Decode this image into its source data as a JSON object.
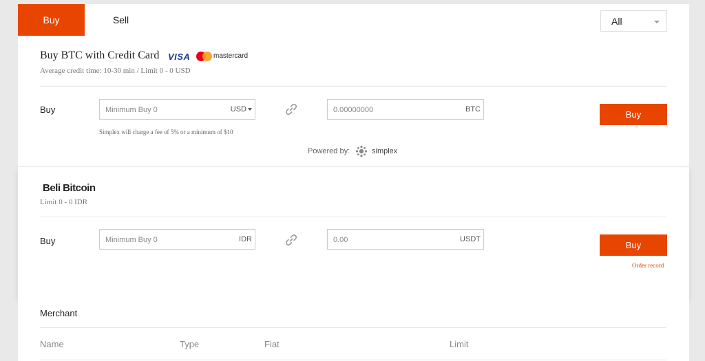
{
  "tabs": {
    "buy": "Buy",
    "sell": "Sell"
  },
  "filter": {
    "selected": "All"
  },
  "card_credit": {
    "title": "Buy BTC with Credit Card",
    "visa": "VISA",
    "mastercard": "mastercard",
    "subtitle": "Average credit time: 10-30 min / Limit 0 - 0 USD",
    "row_label": "Buy",
    "amount_placeholder": "Minimum Buy 0",
    "amount_unit": "USD",
    "crypto_placeholder": "0.00000000",
    "crypto_unit": "BTC",
    "buy_label": "Buy",
    "fee_note": "Simplex will charge a fee of 5% or a minimum of $10",
    "powered_by": "Powered by:",
    "provider": "simplex"
  },
  "card_idr": {
    "title": "Beli Bitcoin",
    "subtitle": "Limit 0 - 0 IDR",
    "row_label": "Buy",
    "amount_placeholder": "Minimum Buy 0",
    "amount_unit": "IDR",
    "crypto_placeholder": "0.00",
    "crypto_unit": "USDT",
    "buy_label": "Buy",
    "order_record": "Order record"
  },
  "merchant": {
    "title": "Merchant",
    "columns": [
      "Name",
      "Type",
      "Fiat",
      "Limit"
    ]
  },
  "colors": {
    "accent": "#e84600"
  }
}
